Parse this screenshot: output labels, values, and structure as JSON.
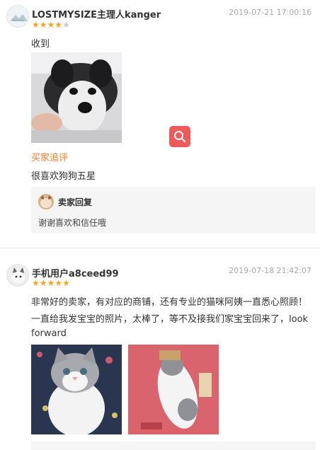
{
  "reviews": [
    {
      "username": "LOSTMYSIZE主理人kanger",
      "date": "2019-07-21 17:00:16",
      "rating": 4,
      "max_rating": 5,
      "text": "收到",
      "followup_label": "买家追评",
      "followup_text": "很喜欢狗狗五星",
      "seller_reply": {
        "title": "卖家回复",
        "text": "谢谢喜欢和信任哦"
      }
    },
    {
      "username": "手机用户a8ceed99",
      "date": "2019-07-18 21:42:07",
      "rating": 5,
      "max_rating": 5,
      "text_line1": "非常好的卖家，有对应的商铺，还有专业的猫咪阿姨一直悉心照顾！",
      "text_line2": "一直给我发宝宝的照片，太棒了，等不及接我们家宝宝回来了，look",
      "text_line3": "forward"
    }
  ],
  "icons": {
    "zoom": "search-icon",
    "colors": {
      "zoom_bg": "#ee5b5b",
      "star": "#f5a623",
      "followup": "#f07c2c"
    }
  }
}
